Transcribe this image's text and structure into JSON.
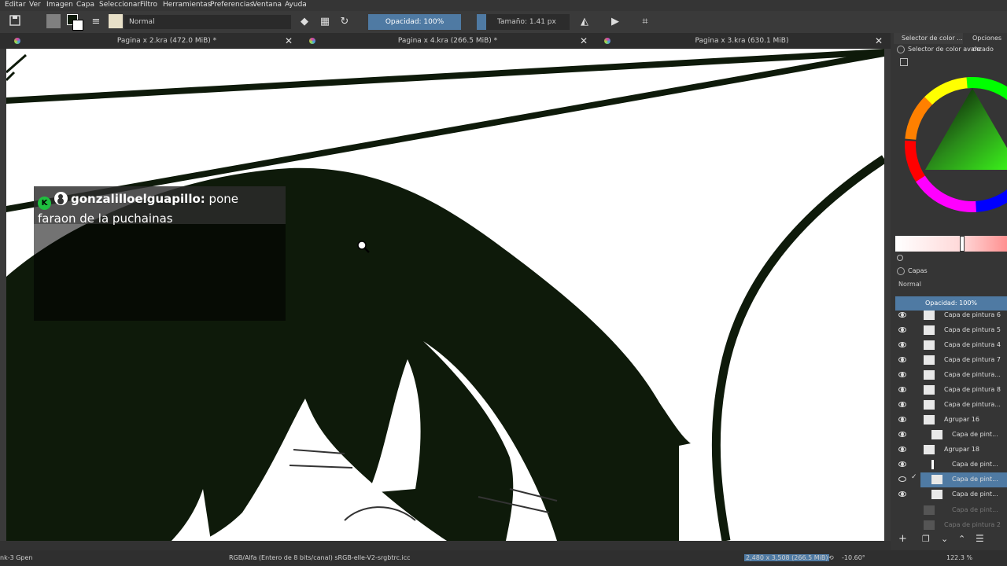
{
  "menu": [
    "Editar",
    "Ver",
    "Imagen",
    "Capa",
    "Seleccionar",
    "Filtro",
    "Herramientas",
    "Preferencias",
    "Ventana",
    "Ayuda"
  ],
  "toolbar": {
    "blend_mode": "Normal",
    "opacity_label": "Opacidad: 100%",
    "size_label": "Tamaño: 1.41 px"
  },
  "tabs": [
    {
      "label": "Pagina x 2.kra (472.0 MiB) *"
    },
    {
      "label": "Pagina x 4.kra (266.5 MiB) *"
    },
    {
      "label": "Pagina x 3.kra (630.1 MiB)"
    }
  ],
  "chat": {
    "username": "gonzalilloelguapillo:",
    "message_line1": "pone",
    "message_line2": "faraon de la puchainas"
  },
  "dock": {
    "tab1": "Selector de color ...",
    "tab2": "Opciones de",
    "color_panel_title": "Selector de color avanzado",
    "layers_title": "Capas",
    "layers_blend": "Normal",
    "layers_opacity": "Opacidad:  100%",
    "layers": [
      {
        "name": "Capa de pintura 6",
        "state": "normal"
      },
      {
        "name": "Capa de pintura 5",
        "state": "normal"
      },
      {
        "name": "Capa de pintura 4",
        "state": "normal"
      },
      {
        "name": "Capa de pintura 7",
        "state": "normal"
      },
      {
        "name": "Capa de pintura...",
        "state": "normal"
      },
      {
        "name": "Capa de pintura 8",
        "state": "normal"
      },
      {
        "name": "Capa de pintura...",
        "state": "normal"
      },
      {
        "name": "Agrupar 16",
        "state": "normal"
      },
      {
        "name": "Capa de pint...",
        "state": "normal"
      },
      {
        "name": "Agrupar 18",
        "state": "normal"
      },
      {
        "name": "Capa de pint...",
        "state": "normal"
      },
      {
        "name": "Capa de pint...",
        "state": "selected"
      },
      {
        "name": "Capa de pint...",
        "state": "normal"
      },
      {
        "name": "Capa de pint...",
        "state": "dim"
      },
      {
        "name": "Capa de pintura 2",
        "state": "dim"
      }
    ]
  },
  "status": {
    "left": "nk-3 Gpen",
    "color_info": "RGB/Alfa (Entero de 8 bits/canal)  sRGB-elle-V2-srgbtrc.icc",
    "dimensions": "2,480 x 3,508 (266.5 MiB)",
    "rotation": "-10.60°",
    "zoom": "122.3 %"
  },
  "colors": {
    "accent": "#4f7aa3",
    "ink": "#0e1a0a"
  }
}
